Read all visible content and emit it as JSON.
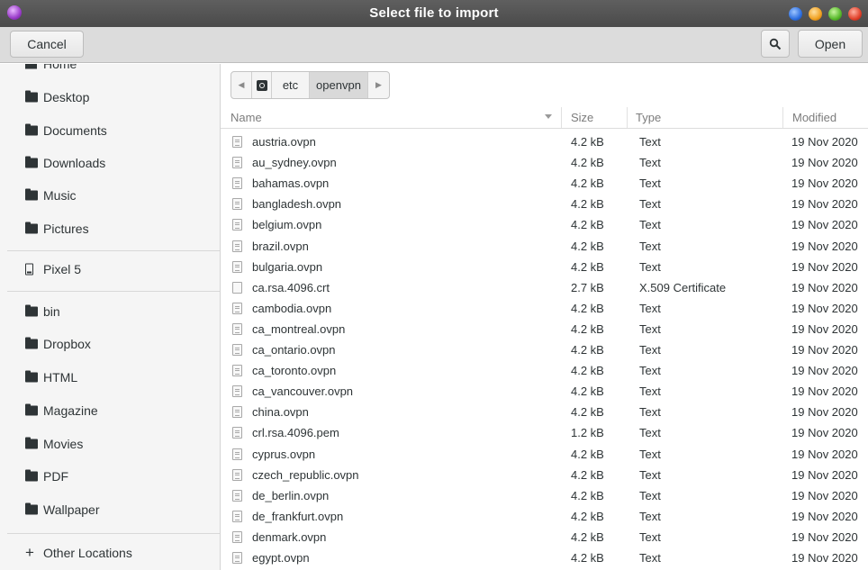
{
  "window": {
    "title": "Select file to import"
  },
  "header": {
    "cancel_label": "Cancel",
    "open_label": "Open"
  },
  "sidebar": {
    "items": [
      {
        "label": "Home",
        "icon": "home-icon"
      },
      {
        "label": "Desktop",
        "icon": "folder-icon"
      },
      {
        "label": "Documents",
        "icon": "folder-icon"
      },
      {
        "label": "Downloads",
        "icon": "folder-icon"
      },
      {
        "label": "Music",
        "icon": "folder-icon"
      },
      {
        "label": "Pictures",
        "icon": "folder-icon"
      },
      {
        "label": "Pixel 5",
        "icon": "phone-icon"
      },
      {
        "label": "bin",
        "icon": "folder-icon"
      },
      {
        "label": "Dropbox",
        "icon": "folder-icon"
      },
      {
        "label": "HTML",
        "icon": "folder-icon"
      },
      {
        "label": "Magazine",
        "icon": "folder-icon"
      },
      {
        "label": "Movies",
        "icon": "folder-icon"
      },
      {
        "label": "PDF",
        "icon": "folder-icon"
      },
      {
        "label": "Wallpaper",
        "icon": "folder-icon"
      },
      {
        "label": "Other Locations",
        "icon": "plus-icon"
      }
    ]
  },
  "pathbar": {
    "segments": [
      "etc",
      "openvpn"
    ]
  },
  "columns": {
    "name": "Name",
    "size": "Size",
    "type": "Type",
    "modified": "Modified"
  },
  "files": [
    {
      "name": "austria.ovpn",
      "size": "4.2 kB",
      "type": "Text",
      "modified": "19 Nov 2020"
    },
    {
      "name": "au_sydney.ovpn",
      "size": "4.2 kB",
      "type": "Text",
      "modified": "19 Nov 2020"
    },
    {
      "name": "bahamas.ovpn",
      "size": "4.2 kB",
      "type": "Text",
      "modified": "19 Nov 2020"
    },
    {
      "name": "bangladesh.ovpn",
      "size": "4.2 kB",
      "type": "Text",
      "modified": "19 Nov 2020"
    },
    {
      "name": "belgium.ovpn",
      "size": "4.2 kB",
      "type": "Text",
      "modified": "19 Nov 2020"
    },
    {
      "name": "brazil.ovpn",
      "size": "4.2 kB",
      "type": "Text",
      "modified": "19 Nov 2020"
    },
    {
      "name": "bulgaria.ovpn",
      "size": "4.2 kB",
      "type": "Text",
      "modified": "19 Nov 2020"
    },
    {
      "name": "ca.rsa.4096.crt",
      "size": "2.7 kB",
      "type": "X.509 Certificate",
      "modified": "19 Nov 2020"
    },
    {
      "name": "cambodia.ovpn",
      "size": "4.2 kB",
      "type": "Text",
      "modified": "19 Nov 2020"
    },
    {
      "name": "ca_montreal.ovpn",
      "size": "4.2 kB",
      "type": "Text",
      "modified": "19 Nov 2020"
    },
    {
      "name": "ca_ontario.ovpn",
      "size": "4.2 kB",
      "type": "Text",
      "modified": "19 Nov 2020"
    },
    {
      "name": "ca_toronto.ovpn",
      "size": "4.2 kB",
      "type": "Text",
      "modified": "19 Nov 2020"
    },
    {
      "name": "ca_vancouver.ovpn",
      "size": "4.2 kB",
      "type": "Text",
      "modified": "19 Nov 2020"
    },
    {
      "name": "china.ovpn",
      "size": "4.2 kB",
      "type": "Text",
      "modified": "19 Nov 2020"
    },
    {
      "name": "crl.rsa.4096.pem",
      "size": "1.2 kB",
      "type": "Text",
      "modified": "19 Nov 2020"
    },
    {
      "name": "cyprus.ovpn",
      "size": "4.2 kB",
      "type": "Text",
      "modified": "19 Nov 2020"
    },
    {
      "name": "czech_republic.ovpn",
      "size": "4.2 kB",
      "type": "Text",
      "modified": "19 Nov 2020"
    },
    {
      "name": "de_berlin.ovpn",
      "size": "4.2 kB",
      "type": "Text",
      "modified": "19 Nov 2020"
    },
    {
      "name": "de_frankfurt.ovpn",
      "size": "4.2 kB",
      "type": "Text",
      "modified": "19 Nov 2020"
    },
    {
      "name": "denmark.ovpn",
      "size": "4.2 kB",
      "type": "Text",
      "modified": "19 Nov 2020"
    },
    {
      "name": "egypt.ovpn",
      "size": "4.2 kB",
      "type": "Text",
      "modified": "19 Nov 2020"
    }
  ]
}
